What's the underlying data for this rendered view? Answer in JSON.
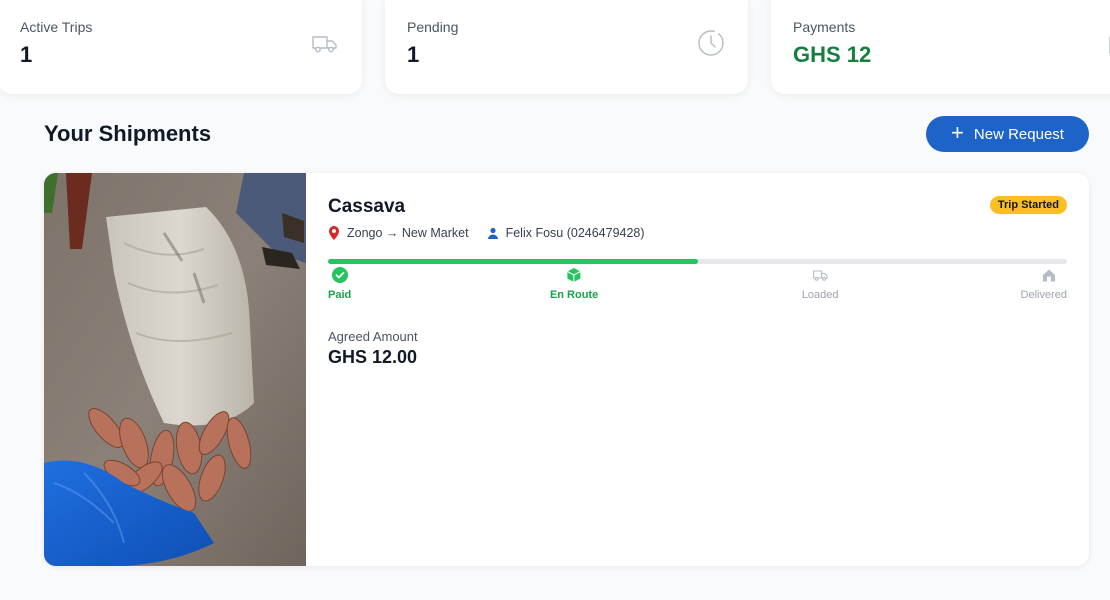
{
  "stats": [
    {
      "label": "Active Trips",
      "value": "1",
      "icon": "truck-icon"
    },
    {
      "label": "Pending",
      "value": "1",
      "icon": "clock-icon"
    },
    {
      "label": "Payments",
      "value": "GHS 12",
      "icon": "wallet-icon",
      "color": "#15803d"
    }
  ],
  "section": {
    "title": "Your Shipments",
    "new_request_label": "New Request"
  },
  "shipment": {
    "cargo": "Cassava",
    "status": "Trip Started",
    "route": "Zongo → New Market",
    "driver": "Felix Fosu (0246479428)",
    "progress_percent": 50,
    "steps": [
      {
        "label": "Paid",
        "state": "done",
        "icon": "check-circle-icon"
      },
      {
        "label": "En Route",
        "state": "done",
        "icon": "box-icon"
      },
      {
        "label": "Loaded",
        "state": "todo",
        "icon": "truck-icon"
      },
      {
        "label": "Delivered",
        "state": "todo",
        "icon": "home-icon"
      }
    ],
    "amount_label": "Agreed Amount",
    "amount": "GHS 12.00",
    "photo": "cassava-sack-photo"
  },
  "colors": {
    "primary": "#1e64c8",
    "success": "#22c55e",
    "payment_green": "#15803d",
    "status_pill": "#fbbf24"
  }
}
